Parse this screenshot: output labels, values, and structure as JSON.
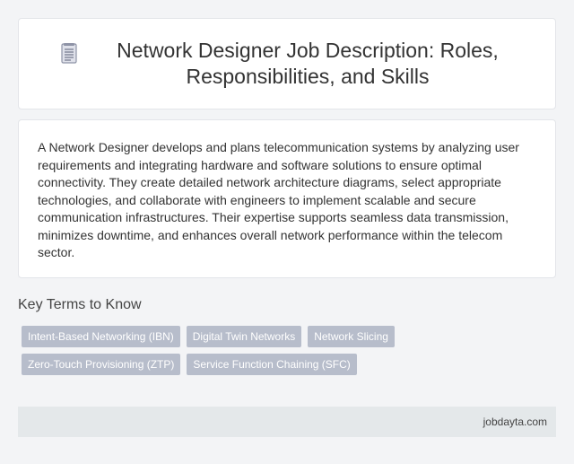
{
  "header": {
    "title": "Network Designer Job Description: Roles, Responsibilities, and Skills",
    "icon": "document-icon"
  },
  "description": {
    "text": "A Network Designer develops and plans telecommunication systems by analyzing user requirements and integrating hardware and software solutions to ensure optimal connectivity. They create detailed network architecture diagrams, select appropriate technologies, and collaborate with engineers to implement scalable and secure communication infrastructures. Their expertise supports seamless data transmission, minimizes downtime, and enhances overall network performance within the telecom sector."
  },
  "key_terms": {
    "heading": "Key Terms to Know",
    "rows": [
      [
        "Intent-Based Networking (IBN)",
        "Digital Twin Networks",
        "Network Slicing"
      ],
      [
        "Zero-Touch Provisioning (ZTP)",
        "Service Function Chaining (SFC)"
      ]
    ]
  },
  "footer": {
    "brand": "jobdayta.com"
  },
  "colors": {
    "background": "#f3f4f6",
    "card": "#ffffff",
    "chip": "#b7bdcb",
    "footer": "#e4e8ea"
  }
}
